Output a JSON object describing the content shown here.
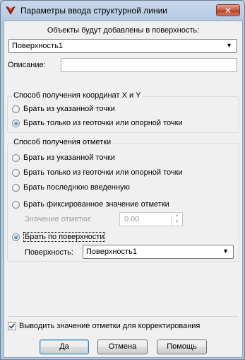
{
  "window": {
    "title": "Параметры ввода структурной линии",
    "close_label": "✕"
  },
  "surface": {
    "label": "Объекты будут добавлены в поверхность:",
    "selected": "Поверхность1"
  },
  "description": {
    "label": "Описание:",
    "value": ""
  },
  "xy_group": {
    "title": "Способ получения координат X и Y",
    "options": [
      {
        "label": "Брать из указанной точки",
        "selected": false
      },
      {
        "label": "Брать только из геоточки или опорной точки",
        "selected": true
      }
    ]
  },
  "elev_group": {
    "title": "Способ получения отметки",
    "options": [
      {
        "label": "Брать из указанной точки",
        "selected": false
      },
      {
        "label": "Брать только из геоточки или опорной точки",
        "selected": false
      },
      {
        "label": "Брать последнюю введенную",
        "selected": false
      },
      {
        "label": "Брать фиксированное значение отметки",
        "selected": false
      },
      {
        "label": "Брать по поверхности",
        "selected": true
      }
    ],
    "elevation_label": "Значение отметки:",
    "elevation_value": "0.00",
    "surface_label": "Поверхность:",
    "surface_value": "Поверхность1"
  },
  "output_checkbox": {
    "label": "Выводить значение отметки для корректирования",
    "checked": true
  },
  "buttons": {
    "ok": "Да",
    "cancel": "Отмена",
    "help": "Помощь"
  }
}
